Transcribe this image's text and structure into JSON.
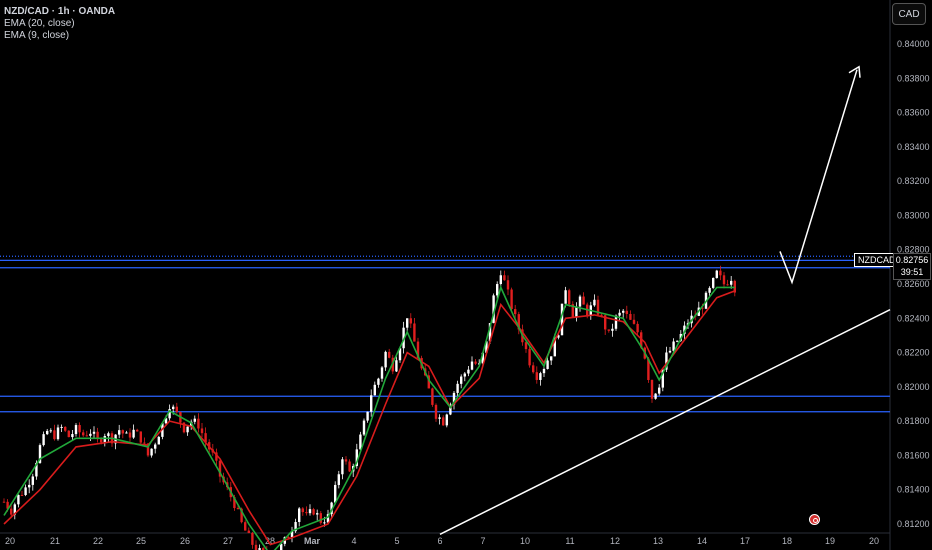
{
  "legend": {
    "symbol": "NZD/CAD · 1h · OANDA",
    "ema20": "EMA (20, close)",
    "ema9": "EMA (9, close)"
  },
  "currency_button": "CAD",
  "price_tag": {
    "symbol": "NZDCAD",
    "price": "0.82756",
    "countdown": "39:51"
  },
  "colors": {
    "background": "#000000",
    "up_candle": "#ffffff",
    "down_candle": "#e01f1f",
    "ema20": "#d81c1c",
    "ema9": "#21a83a",
    "horizontal_lines": "#2962ff",
    "trendline": "#ffffff"
  },
  "chart_data": {
    "type": "candlestick",
    "title": "NZD/CAD · 1h · OANDA",
    "y_ticks": [
      "0.84000",
      "0.83800",
      "0.83600",
      "0.83400",
      "0.83200",
      "0.83000",
      "0.82800",
      "0.82600",
      "0.82400",
      "0.82200",
      "0.82000",
      "0.81800",
      "0.81600",
      "0.81400",
      "0.81200"
    ],
    "ylim": [
      0.8117,
      0.8425
    ],
    "x_ticks": [
      "20",
      "21",
      "22",
      "25",
      "26",
      "27",
      "28",
      "Mar",
      "4",
      "5",
      "6",
      "7",
      "10",
      "11",
      "12",
      "13",
      "14",
      "17",
      "18",
      "19",
      "20"
    ],
    "current_price": 0.82756,
    "horizontal_levels": [
      0.82762,
      0.82738,
      0.82695,
      0.81945,
      0.81855
    ],
    "price_path": [
      [
        0,
        0.8133
      ],
      [
        2,
        0.8128
      ],
      [
        4,
        0.8136
      ],
      [
        6,
        0.8141
      ],
      [
        8,
        0.815
      ],
      [
        10,
        0.8165
      ],
      [
        12,
        0.8174
      ],
      [
        14,
        0.8172
      ],
      [
        16,
        0.8176
      ],
      [
        18,
        0.8171
      ],
      [
        20,
        0.8175
      ],
      [
        22,
        0.8172
      ],
      [
        24,
        0.8174
      ],
      [
        26,
        0.8168
      ],
      [
        28,
        0.8173
      ],
      [
        30,
        0.817
      ],
      [
        32,
        0.8175
      ],
      [
        34,
        0.8171
      ],
      [
        36,
        0.8174
      ],
      [
        38,
        0.817
      ],
      [
        40,
        0.816
      ],
      [
        42,
        0.8168
      ],
      [
        44,
        0.8178
      ],
      [
        46,
        0.819
      ],
      [
        48,
        0.8184
      ],
      [
        50,
        0.8176
      ],
      [
        52,
        0.818
      ],
      [
        54,
        0.8178
      ],
      [
        56,
        0.8168
      ],
      [
        58,
        0.816
      ],
      [
        60,
        0.8148
      ],
      [
        62,
        0.814
      ],
      [
        64,
        0.8132
      ],
      [
        66,
        0.812
      ],
      [
        68,
        0.8112
      ],
      [
        70,
        0.8105
      ],
      [
        72,
        0.8102
      ],
      [
        74,
        0.81
      ],
      [
        76,
        0.8104
      ],
      [
        78,
        0.811
      ],
      [
        80,
        0.8118
      ],
      [
        82,
        0.813
      ],
      [
        84,
        0.8124
      ],
      [
        86,
        0.8128
      ],
      [
        88,
        0.8122
      ],
      [
        90,
        0.8124
      ],
      [
        92,
        0.814
      ],
      [
        94,
        0.816
      ],
      [
        96,
        0.815
      ],
      [
        98,
        0.8162
      ],
      [
        100,
        0.8178
      ],
      [
        102,
        0.8196
      ],
      [
        104,
        0.8205
      ],
      [
        106,
        0.822
      ],
      [
        108,
        0.8212
      ],
      [
        110,
        0.8225
      ],
      [
        112,
        0.8242
      ],
      [
        114,
        0.8226
      ],
      [
        116,
        0.821
      ],
      [
        118,
        0.8198
      ],
      [
        120,
        0.8184
      ],
      [
        122,
        0.818
      ],
      [
        124,
        0.8192
      ],
      [
        126,
        0.8202
      ],
      [
        128,
        0.8208
      ],
      [
        130,
        0.8215
      ],
      [
        132,
        0.8212
      ],
      [
        134,
        0.8225
      ],
      [
        136,
        0.8252
      ],
      [
        138,
        0.8268
      ],
      [
        140,
        0.8254
      ],
      [
        142,
        0.824
      ],
      [
        144,
        0.8228
      ],
      [
        146,
        0.8215
      ],
      [
        148,
        0.8207
      ],
      [
        150,
        0.8212
      ],
      [
        152,
        0.822
      ],
      [
        154,
        0.8233
      ],
      [
        156,
        0.8258
      ],
      [
        158,
        0.8243
      ],
      [
        160,
        0.825
      ],
      [
        162,
        0.8244
      ],
      [
        164,
        0.8248
      ],
      [
        166,
        0.824
      ],
      [
        168,
        0.823
      ],
      [
        170,
        0.824
      ],
      [
        172,
        0.8244
      ],
      [
        174,
        0.8238
      ],
      [
        176,
        0.8232
      ],
      [
        178,
        0.8218
      ],
      [
        180,
        0.8194
      ],
      [
        182,
        0.8202
      ],
      [
        184,
        0.8218
      ],
      [
        186,
        0.8224
      ],
      [
        188,
        0.823
      ],
      [
        190,
        0.8238
      ],
      [
        192,
        0.8242
      ],
      [
        194,
        0.8248
      ],
      [
        196,
        0.8256
      ],
      [
        198,
        0.8266
      ],
      [
        200,
        0.826
      ],
      [
        202,
        0.8264
      ],
      [
        203,
        0.8258
      ]
    ],
    "ema20_path": [
      [
        0,
        0.812
      ],
      [
        10,
        0.814
      ],
      [
        20,
        0.8165
      ],
      [
        30,
        0.8168
      ],
      [
        40,
        0.8166
      ],
      [
        46,
        0.818
      ],
      [
        52,
        0.8177
      ],
      [
        60,
        0.8158
      ],
      [
        68,
        0.8128
      ],
      [
        74,
        0.8108
      ],
      [
        80,
        0.8112
      ],
      [
        90,
        0.812
      ],
      [
        98,
        0.8148
      ],
      [
        106,
        0.819
      ],
      [
        112,
        0.822
      ],
      [
        118,
        0.8212
      ],
      [
        124,
        0.8188
      ],
      [
        132,
        0.8205
      ],
      [
        138,
        0.8248
      ],
      [
        144,
        0.8232
      ],
      [
        150,
        0.8214
      ],
      [
        156,
        0.824
      ],
      [
        164,
        0.8242
      ],
      [
        172,
        0.8238
      ],
      [
        178,
        0.8226
      ],
      [
        182,
        0.8208
      ],
      [
        190,
        0.823
      ],
      [
        198,
        0.8252
      ],
      [
        203,
        0.8256
      ]
    ],
    "ema9_path": [
      [
        0,
        0.8125
      ],
      [
        10,
        0.8158
      ],
      [
        20,
        0.817
      ],
      [
        30,
        0.817
      ],
      [
        40,
        0.8165
      ],
      [
        46,
        0.8186
      ],
      [
        52,
        0.8179
      ],
      [
        60,
        0.815
      ],
      [
        68,
        0.812
      ],
      [
        74,
        0.8102
      ],
      [
        80,
        0.8116
      ],
      [
        90,
        0.8124
      ],
      [
        98,
        0.8156
      ],
      [
        106,
        0.8205
      ],
      [
        112,
        0.8232
      ],
      [
        118,
        0.8204
      ],
      [
        124,
        0.8188
      ],
      [
        132,
        0.8212
      ],
      [
        138,
        0.8258
      ],
      [
        144,
        0.823
      ],
      [
        150,
        0.8212
      ],
      [
        156,
        0.8248
      ],
      [
        164,
        0.8244
      ],
      [
        172,
        0.824
      ],
      [
        178,
        0.822
      ],
      [
        182,
        0.8204
      ],
      [
        190,
        0.8236
      ],
      [
        198,
        0.8258
      ],
      [
        203,
        0.8258
      ]
    ],
    "trendline": [
      [
        0.8114,
        0.5
      ],
      [
        0.8245,
        1.0
      ]
    ],
    "projection_arrow": [
      [
        0.827,
        0.8385
      ]
    ]
  }
}
